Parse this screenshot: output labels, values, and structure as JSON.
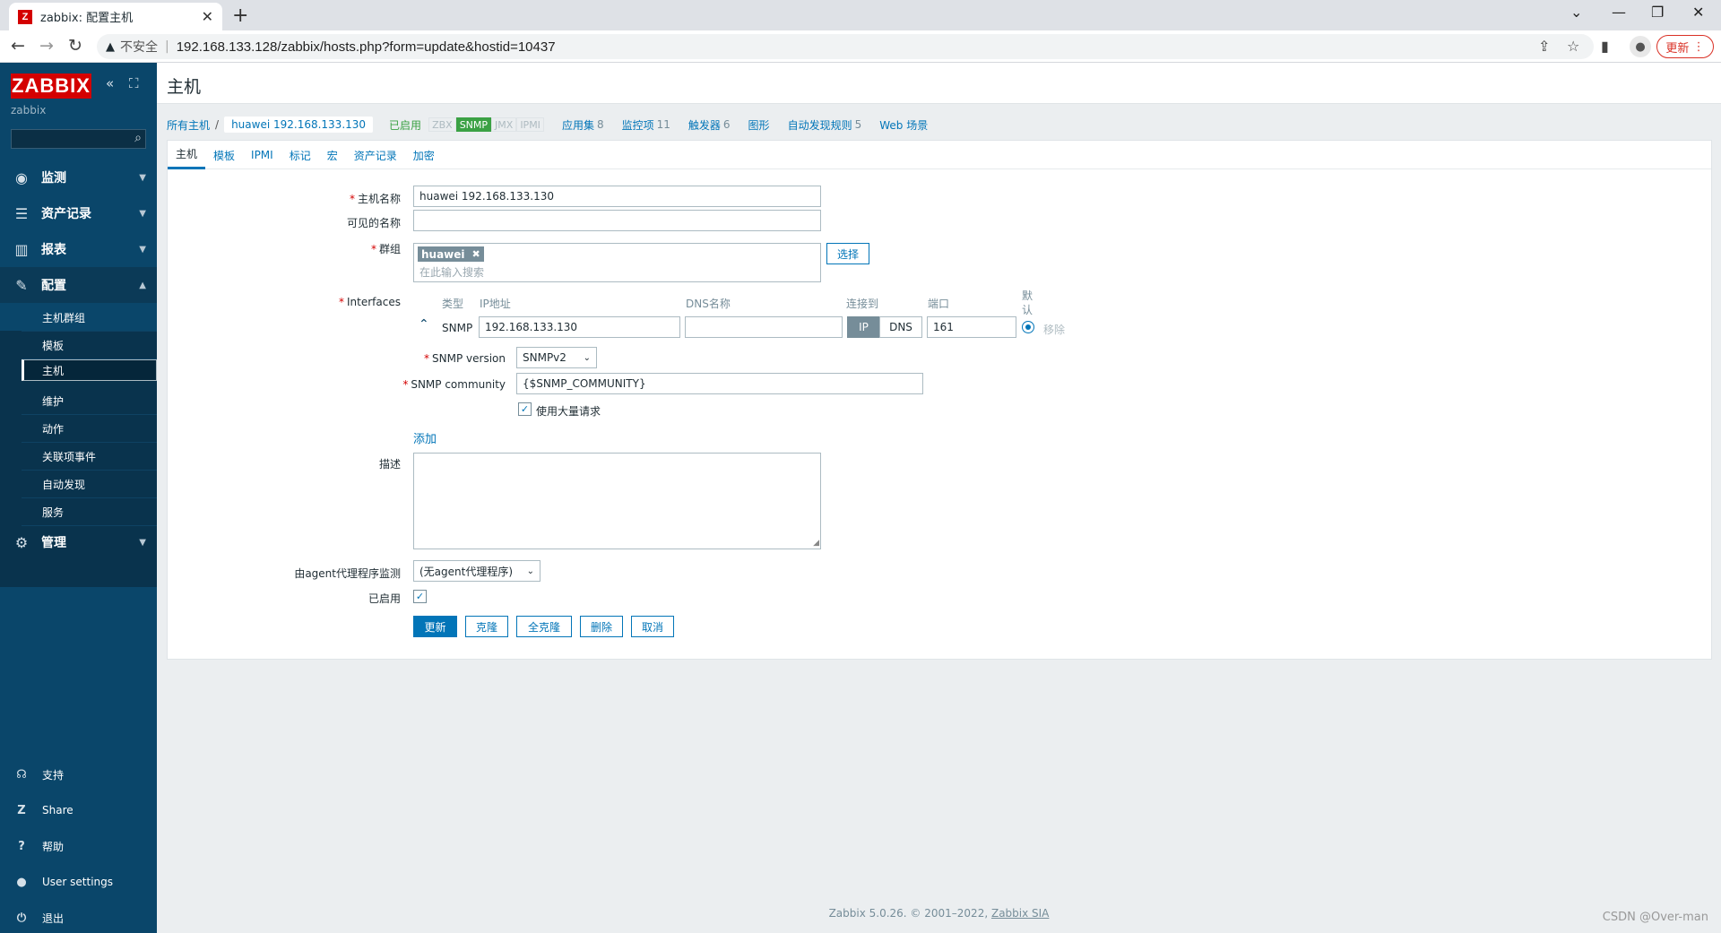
{
  "browser": {
    "tab_title": "zabbix: 配置主机",
    "favicon_letter": "Z",
    "new_tab": "+",
    "insecure_label": "不安全",
    "url": "192.168.133.128/zabbix/hosts.php?form=update&hostid=10437",
    "update_label": "更新"
  },
  "sidebar": {
    "logo": "ZABBIX",
    "subtitle": "zabbix",
    "menu": [
      {
        "label": "监测",
        "icon": "eye-icon"
      },
      {
        "label": "资产记录",
        "icon": "list-icon"
      },
      {
        "label": "报表",
        "icon": "chart-icon"
      },
      {
        "label": "配置",
        "icon": "wrench-icon"
      },
      {
        "label": "管理",
        "icon": "gear-icon"
      }
    ],
    "config_items": [
      "主机群组",
      "模板",
      "主机",
      "维护",
      "动作",
      "关联项事件",
      "自动发现",
      "服务"
    ],
    "footer": [
      {
        "label": "支持",
        "glyph": "☊"
      },
      {
        "label": "Share",
        "glyph": "Z"
      },
      {
        "label": "帮助",
        "glyph": "?"
      },
      {
        "label": "User settings",
        "glyph": "👤"
      },
      {
        "label": "退出",
        "glyph": "⏻"
      }
    ]
  },
  "page": {
    "title": "主机"
  },
  "breadcrumb": {
    "all_hosts": "所有主机",
    "separator": "/",
    "current": "huawei 192.168.133.130",
    "status": "已启用",
    "badges": {
      "zbx": "ZBX",
      "snmp": "SNMP",
      "jmx": "JMX",
      "ipmi": "IPMI"
    },
    "links": [
      {
        "label": "应用集",
        "count": "8"
      },
      {
        "label": "监控项",
        "count": "11"
      },
      {
        "label": "触发器",
        "count": "6"
      },
      {
        "label": "图形",
        "count": ""
      },
      {
        "label": "自动发现规则",
        "count": "5"
      },
      {
        "label": "Web 场景",
        "count": ""
      }
    ]
  },
  "tabs": [
    "主机",
    "模板",
    "IPMI",
    "标记",
    "宏",
    "资产记录",
    "加密"
  ],
  "form": {
    "host_name_label": "主机名称",
    "host_name_value": "huawei 192.168.133.130",
    "visible_name_label": "可见的名称",
    "visible_name_value": "",
    "groups_label": "群组",
    "group_chip": "huawei",
    "groups_placeholder": "在此输入搜索",
    "select_button": "选择",
    "interfaces_label": "Interfaces",
    "col_type": "类型",
    "col_ip": "IP地址",
    "col_dns": "DNS名称",
    "col_connect": "连接到",
    "col_port": "端口",
    "col_default_1": "默",
    "col_default_2": "认",
    "iface_type": "SNMP",
    "iface_ip": "192.168.133.130",
    "iface_dns": "",
    "connect_ip": "IP",
    "connect_dns": "DNS",
    "iface_port": "161",
    "remove_label": "移除",
    "snmp_version_label": "SNMP version",
    "snmp_version_value": "SNMPv2",
    "snmp_community_label": "SNMP community",
    "snmp_community_value": "{$SNMP_COMMUNITY}",
    "bulk_label": "使用大量请求",
    "add_link": "添加",
    "description_label": "描述",
    "proxy_label": "由agent代理程序监测",
    "proxy_value": "(无agent代理程序)",
    "enabled_label": "已启用"
  },
  "buttons": {
    "update": "更新",
    "clone": "克隆",
    "full_clone": "全克隆",
    "delete": "删除",
    "cancel": "取消"
  },
  "footer": {
    "text": "Zabbix 5.0.26. © 2001–2022, ",
    "link": "Zabbix SIA"
  },
  "watermark": "CSDN @Over-man"
}
